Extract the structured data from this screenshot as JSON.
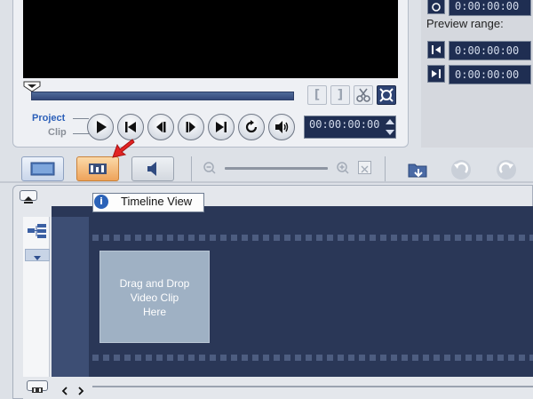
{
  "player": {
    "mode_project": "Project",
    "mode_clip": "Clip",
    "timecode": "00:00:00:00",
    "trim_start_label": "[",
    "trim_end_label": "]"
  },
  "preview_range": {
    "label": "Preview range:",
    "top_value": "0:00:00:00",
    "start_value": "0:00:00:00",
    "end_value": "0:00:00:00"
  },
  "tooltip": {
    "icon": "i",
    "text": "Timeline View"
  },
  "timeline": {
    "drop_text_line1": "Drag and Drop",
    "drop_text_line2": "Video Clip",
    "drop_text_line3": "Here"
  },
  "colors": {
    "mode_project": "#2b5fb9",
    "mode_clip": "#8a8f98",
    "timecode_bg": "#1f2e52",
    "timeline_bg": "#2a3757",
    "drop_zone": "#9fb1c4",
    "active_tab": "#f2b46a",
    "pointer_arrow": "#e22424"
  },
  "icons": [
    "storyboard-view-icon",
    "timeline-view-icon",
    "audio-view-icon",
    "zoom-out-icon",
    "zoom-in-icon",
    "fit-icon",
    "import-icon",
    "undo-icon",
    "redo-icon"
  ]
}
